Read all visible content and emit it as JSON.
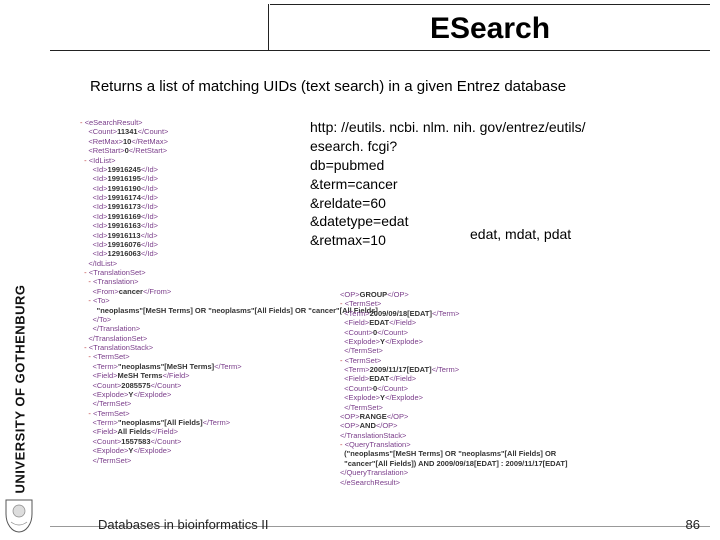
{
  "sidebar": {
    "university": "UNIVERSITY OF GOTHENBURG"
  },
  "header": {
    "title": "ESearch"
  },
  "subtitle": "Returns a list of matching UIDs (text search) in a given Entrez database",
  "url": {
    "l1": "http: //eutils. ncbi. nlm. nih. gov/entrez/eutils/",
    "l2": "esearch. fcgi?",
    "l3": "db=pubmed",
    "l4": "&term=cancer",
    "l5": "&reldate=60",
    "l6": "&datetype=edat",
    "l7": "&retmax=10"
  },
  "annotation": "edat, mdat, pdat",
  "xml_left": [
    {
      "i": 0,
      "p": "- ",
      "t": "<eSearchResult>"
    },
    {
      "i": 2,
      "t": "<Count>",
      "v": "11341",
      "c": "</Count>"
    },
    {
      "i": 2,
      "t": "<RetMax>",
      "v": "10",
      "c": "</RetMax>"
    },
    {
      "i": 2,
      "t": "<RetStart>",
      "v": "0",
      "c": "</RetStart>"
    },
    {
      "i": 1,
      "p": "- ",
      "t": "<IdList>"
    },
    {
      "i": 3,
      "t": "<Id>",
      "v": "19916245",
      "c": "</Id>"
    },
    {
      "i": 3,
      "t": "<Id>",
      "v": "19916195",
      "c": "</Id>"
    },
    {
      "i": 3,
      "t": "<Id>",
      "v": "19916190",
      "c": "</Id>"
    },
    {
      "i": 3,
      "t": "<Id>",
      "v": "19916174",
      "c": "</Id>"
    },
    {
      "i": 3,
      "t": "<Id>",
      "v": "19916173",
      "c": "</Id>"
    },
    {
      "i": 3,
      "t": "<Id>",
      "v": "19916169",
      "c": "</Id>"
    },
    {
      "i": 3,
      "t": "<Id>",
      "v": "19916163",
      "c": "</Id>"
    },
    {
      "i": 3,
      "t": "<Id>",
      "v": "19916113",
      "c": "</Id>"
    },
    {
      "i": 3,
      "t": "<Id>",
      "v": "19916076",
      "c": "</Id>"
    },
    {
      "i": 3,
      "t": "<Id>",
      "v": "12916063",
      "c": "</Id>"
    },
    {
      "i": 2,
      "t": "</IdList>"
    },
    {
      "i": 1,
      "p": "- ",
      "t": "<TranslationSet>"
    },
    {
      "i": 2,
      "p": "- ",
      "t": "<Translation>"
    },
    {
      "i": 3,
      "t": "<From>",
      "v": "cancer",
      "c": "</From>"
    },
    {
      "i": 2,
      "p": "- ",
      "t": "<To>"
    },
    {
      "i": 4,
      "v": "\"neoplasms\"[MeSH Terms] OR \"neoplasms\"[All Fields] OR \"cancer\"[All Fields]"
    },
    {
      "i": 3,
      "t": "</To>"
    },
    {
      "i": 3,
      "t": "</Translation>"
    },
    {
      "i": 2,
      "t": "</TranslationSet>"
    },
    {
      "i": 1,
      "p": "- ",
      "t": "<TranslationStack>"
    },
    {
      "i": 2,
      "p": "- ",
      "t": "<TermSet>"
    },
    {
      "i": 3,
      "t": "<Term>",
      "v": "\"neoplasms\"[MeSH Terms]",
      "c": "</Term>"
    },
    {
      "i": 3,
      "t": "<Field>",
      "v": "MeSH Terms",
      "c": "</Field>"
    },
    {
      "i": 3,
      "t": "<Count>",
      "v": "2085575",
      "c": "</Count>"
    },
    {
      "i": 3,
      "t": "<Explode>",
      "v": "Y",
      "c": "</Explode>"
    },
    {
      "i": 3,
      "t": "</TermSet>"
    },
    {
      "i": 2,
      "p": "- ",
      "t": "<TermSet>"
    },
    {
      "i": 3,
      "t": "<Term>",
      "v": "\"neoplasms\"[All Fields]",
      "c": "</Term>"
    },
    {
      "i": 3,
      "t": "<Field>",
      "v": "All Fields",
      "c": "</Field>"
    },
    {
      "i": 3,
      "t": "<Count>",
      "v": "1557583",
      "c": "</Count>"
    },
    {
      "i": 3,
      "t": "<Explode>",
      "v": "Y",
      "c": "</Explode>"
    },
    {
      "i": 3,
      "t": "</TermSet>"
    }
  ],
  "xml_right": [
    {
      "i": 0,
      "t": "<OP>",
      "v": "GROUP",
      "c": "</OP>"
    },
    {
      "i": 0,
      "p": "- ",
      "t": "<TermSet>"
    },
    {
      "i": 1,
      "t": "<Term>",
      "v": "2009/09/18[EDAT]",
      "c": "</Term>"
    },
    {
      "i": 1,
      "t": "<Field>",
      "v": "EDAT",
      "c": "</Field>"
    },
    {
      "i": 1,
      "t": "<Count>",
      "v": "0",
      "c": "</Count>"
    },
    {
      "i": 1,
      "t": "<Explode>",
      "v": "Y",
      "c": "</Explode>"
    },
    {
      "i": 1,
      "t": "</TermSet>"
    },
    {
      "i": 0,
      "p": "- ",
      "t": "<TermSet>"
    },
    {
      "i": 1,
      "t": "<Term>",
      "v": "2009/11/17[EDAT]",
      "c": "</Term>"
    },
    {
      "i": 1,
      "t": "<Field>",
      "v": "EDAT",
      "c": "</Field>"
    },
    {
      "i": 1,
      "t": "<Count>",
      "v": "0",
      "c": "</Count>"
    },
    {
      "i": 1,
      "t": "<Explode>",
      "v": "Y",
      "c": "</Explode>"
    },
    {
      "i": 1,
      "t": "</TermSet>"
    },
    {
      "i": 0,
      "t": "<OP>",
      "v": "RANGE",
      "c": "</OP>"
    },
    {
      "i": 0,
      "t": "<OP>",
      "v": "AND",
      "c": "</OP>"
    },
    {
      "i": 0,
      "t": "</TranslationStack>"
    },
    {
      "i": 0,
      "p": "- ",
      "t": "<QueryTranslation>"
    },
    {
      "i": 1,
      "v": "(\"neoplasms\"[MeSH Terms] OR \"neoplasms\"[All Fields] OR"
    },
    {
      "i": 1,
      "v": "\"cancer\"[All Fields]) AND 2009/09/18[EDAT] : 2009/11/17[EDAT]"
    },
    {
      "i": 0,
      "t": "</QueryTranslation>"
    },
    {
      "i": 0,
      "t": "</eSearchResult>"
    }
  ],
  "footer": {
    "course": "Databases in bioinformatics II",
    "page": "86"
  }
}
